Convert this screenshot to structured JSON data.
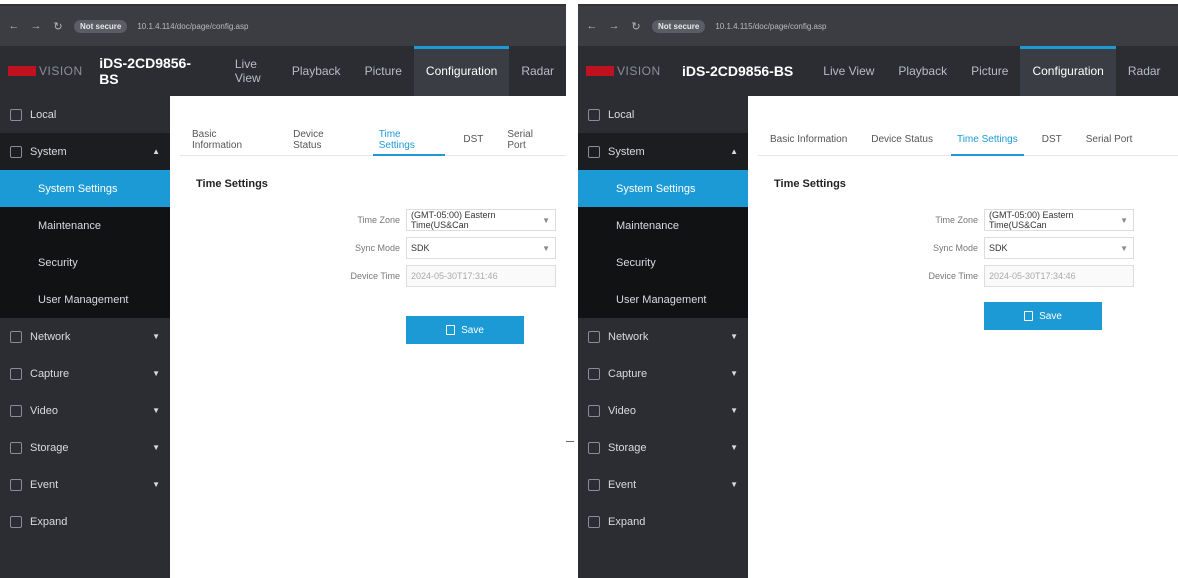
{
  "browser": {
    "insecure_label": "Not secure",
    "url_left": "10.1.4.114/doc/page/config.asp",
    "url_right": "10.1.4.115/doc/page/config.asp"
  },
  "app": {
    "brand": "VISION",
    "model": "iDS-2CD9856-BS",
    "topnav": [
      "Live View",
      "Playback",
      "Picture",
      "Configuration",
      "Radar"
    ],
    "active_topnav": "Configuration"
  },
  "sidebar": {
    "local": "Local",
    "system": "System",
    "system_sub": [
      "System Settings",
      "Maintenance",
      "Security",
      "User Management"
    ],
    "network": "Network",
    "capture": "Capture",
    "video": "Video",
    "storage": "Storage",
    "event": "Event",
    "expand": "Expand"
  },
  "tabs": [
    "Basic Information",
    "Device Status",
    "Time Settings",
    "DST",
    "Serial Port"
  ],
  "form": {
    "title": "Time Settings",
    "time_zone_label": "Time Zone",
    "time_zone_value": "(GMT-05:00) Eastern Time(US&Can",
    "sync_mode_label": "Sync Mode",
    "sync_mode_value": "SDK",
    "device_time_label": "Device Time",
    "device_time_left": "2024-05-30T17:31:46",
    "device_time_right": "2024-05-30T17:34:46",
    "save_label": "Save"
  },
  "colors": {
    "accent": "#1b9ad6",
    "brand_red": "#c0121e",
    "sidebar": "#2b2d33"
  }
}
